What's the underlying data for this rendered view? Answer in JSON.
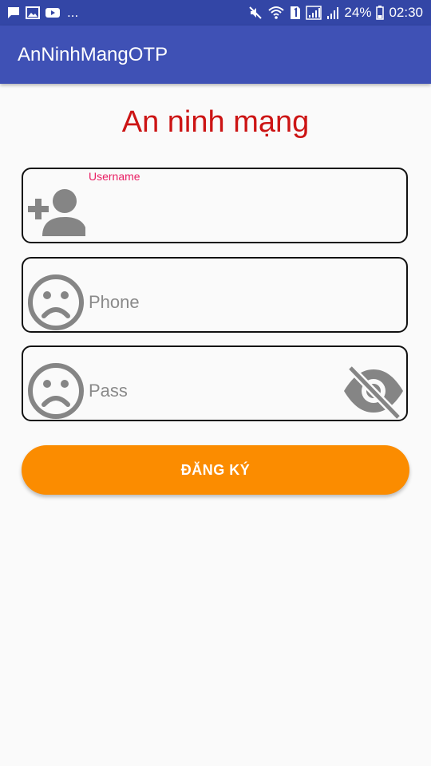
{
  "status_bar": {
    "icons_left": [
      "message-icon",
      "image-icon",
      "youtube-icon"
    ],
    "overflow_dots": "...",
    "icons_right": [
      "mute-icon",
      "wifi-icon",
      "sim-1-icon",
      "signal-icon",
      "signal-icon"
    ],
    "battery": "24%",
    "time": "02:30",
    "colors": {
      "background": "#3346a6",
      "foreground": "#ffffff"
    }
  },
  "app_bar": {
    "title": "AnNinhMangOTP",
    "color": "#3f51b5"
  },
  "page": {
    "title": "An ninh mạng",
    "title_color": "#cc1414"
  },
  "form": {
    "username": {
      "floating_label": "Username",
      "value": "",
      "icon": "add-person-icon",
      "label_color": "#e91e63"
    },
    "phone": {
      "placeholder": "Phone",
      "value": "",
      "icon": "sad-face-icon"
    },
    "password": {
      "placeholder": "Pass",
      "value": "",
      "icon": "sad-face-icon",
      "toggle_icon": "eye-off-icon"
    },
    "register_button": {
      "label": "ĐĂNG KÝ",
      "color": "#fb8c00"
    }
  }
}
